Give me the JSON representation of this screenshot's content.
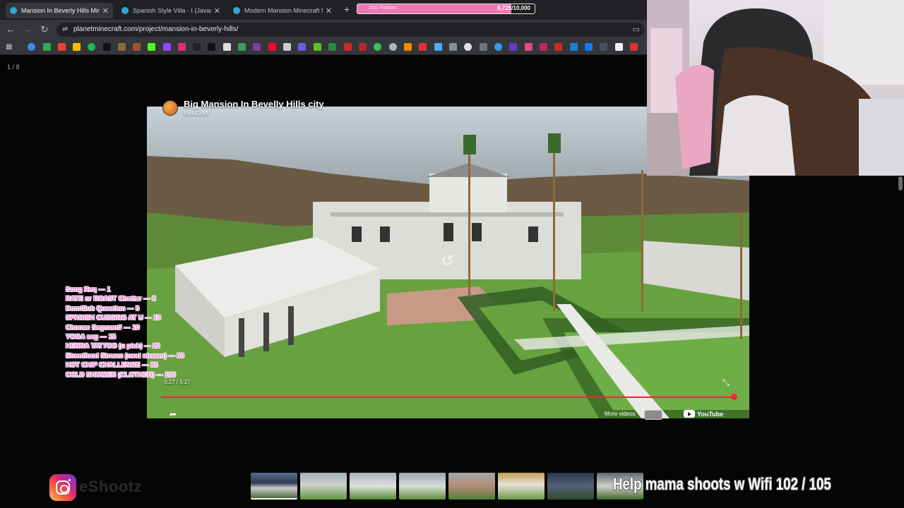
{
  "browser": {
    "tabs": [
      {
        "title": "Mansion In Beverly Hills Minec",
        "active": true
      },
      {
        "title": "Spanish Style Villa - I (Java/Bed",
        "active": false
      },
      {
        "title": "Modern Mansion Minecraft Ma",
        "active": false
      }
    ],
    "url": "planetminecraft.com/project/mansion-in-beverly-hills/",
    "goal_bar": {
      "label": "X5G Follows",
      "current": "8,725",
      "target": "10,000",
      "fraction": 0.87
    }
  },
  "page": {
    "counter": "1 / 8"
  },
  "video": {
    "title": "Big Mansion In Bevelly Hills city",
    "channel": "BuildCraft",
    "timestamp": "5:27 / 5:27",
    "progress_fraction": 1.0,
    "more_videos_label": "More videos",
    "youtube_label": "YouTube"
  },
  "overlay": {
    "commands": [
      "Song Req — 1",
      "RATE or ROAST Chatter — 8",
      "Dom/Sub Question — 5",
      "SPANISH CUSSING AT U — 10",
      "Choose Segment! — 10",
      "YOGA seg — 15",
      "HENNA TATTOO (u pick) — 20",
      "Streetfood Stream (next stream) — 30",
      "HOT CHIP CHALLENGE — 35",
      "COLD SHOWER (CLOTHED) — 100"
    ],
    "instagram_handle": "eShootz",
    "wifi_goal": "Help mama shoots w Wifi  102 / 105"
  },
  "colors": {
    "accent_pink": "#f07ad9",
    "seek_red": "#ff1f3d",
    "chrome_dark": "#202124",
    "chrome_toolbar": "#35363a"
  }
}
